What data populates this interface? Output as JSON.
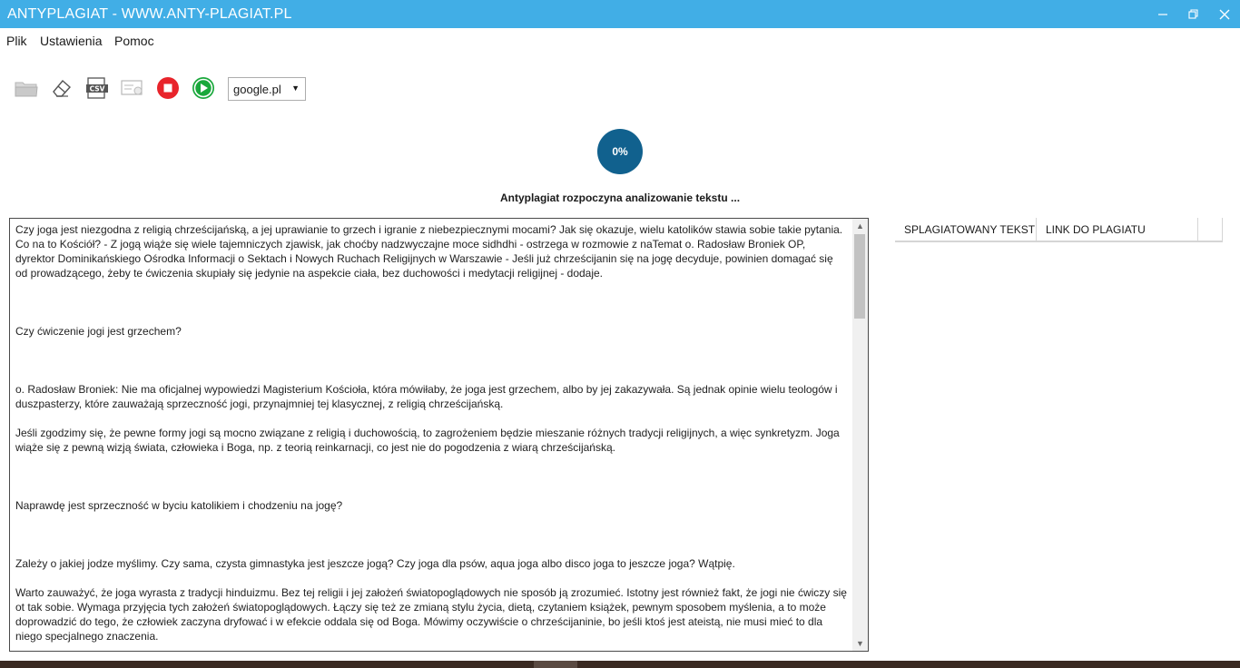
{
  "window": {
    "title": "ANTYPLAGIAT - WWW.ANTY-PLAGIAT.PL"
  },
  "menu": {
    "items": [
      "Plik",
      "Ustawienia",
      "Pomoc"
    ]
  },
  "toolbar": {
    "icons": [
      "open-folder-icon",
      "eraser-icon",
      "csv-export-icon",
      "certificate-icon",
      "stop-icon",
      "play-icon"
    ],
    "search_engine": "google.pl"
  },
  "progress": {
    "percent_label": "0%",
    "value": 0,
    "status": "Antyplagiat rozpoczyna analizowanie tekstu ..."
  },
  "document": {
    "paragraphs": [
      "Czy joga jest niezgodna z religią chrześcijańską, a jej uprawianie to grzech i igranie z niebezpiecznymi mocami? Jak się okazuje, wielu katolików stawia sobie takie pytania. Co na to Kościół? - Z jogą wiąże się wiele tajemniczych zjawisk, jak choćby nadzwyczajne moce sidhdhi - ostrzega w rozmowie z naTemat o. Radosław Broniek OP, dyrektor Dominikańskiego Ośrodka Informacji o Sektach i Nowych Ruchach Religijnych w Warszawie - Jeśli już chrześcijanin się na jogę decyduje, powinien domagać się od prowadzącego, żeby te ćwiczenia skupiały się jedynie na aspekcie ciała, bez duchowości i medytacji religijnej - dodaje.",
      "Czy ćwiczenie jogi jest grzechem?",
      "o. Radosław Broniek: Nie ma oficjalnej wypowiedzi Magisterium Kościoła, która mówiłaby, że joga jest grzechem, albo by jej zakazywała. Są jednak opinie wielu teologów i duszpasterzy, które zauważają sprzeczność jogi, przynajmniej tej klasycznej, z religią chrześcijańską.",
      "Jeśli zgodzimy się, że pewne formy jogi są mocno związane z religią i duchowością, to zagrożeniem będzie mieszanie różnych tradycji religijnych, a więc synkretyzm. Joga wiąże się z pewną wizją świata, człowieka i Boga, np. z teorią reinkarnacji, co jest nie do pogodzenia z wiarą chrześcijańską.",
      "Naprawdę jest sprzeczność w byciu katolikiem i chodzeniu na jogę?",
      "Zależy o jakiej jodze myślimy. Czy sama, czysta gimnastyka jest jeszcze jogą? Czy joga dla psów, aqua joga albo disco joga to jeszcze joga? Wątpię.",
      "Warto zauważyć, że joga wyrasta z tradycji hinduizmu. Bez tej religii i jej założeń światopoglądowych nie sposób ją zrozumieć. Istotny jest również fakt, że jogi nie ćwiczy się ot tak sobie. Wymaga przyjęcia tych założeń światopoglądowych. Łączy się też ze zmianą stylu życia, dietą, czytaniem książek, pewnym sposobem myślenia, a to może doprowadzić do tego, że człowiek zaczyna dryfować i w efekcie oddala się od Boga. Mówimy oczywiście o chrześcijaninie, bo jeśli ktoś jest ateistą, nie musi mieć to dla niego specjalnego znaczenia."
    ]
  },
  "results": {
    "columns": [
      "SPLAGIATOWANY TEKST",
      "LINK DO PLAGIATU"
    ],
    "rows": []
  },
  "colors": {
    "titlebar": "#41aee6",
    "progress": "#11618e",
    "stop": "#e8242b",
    "play": "#1aa83c"
  }
}
